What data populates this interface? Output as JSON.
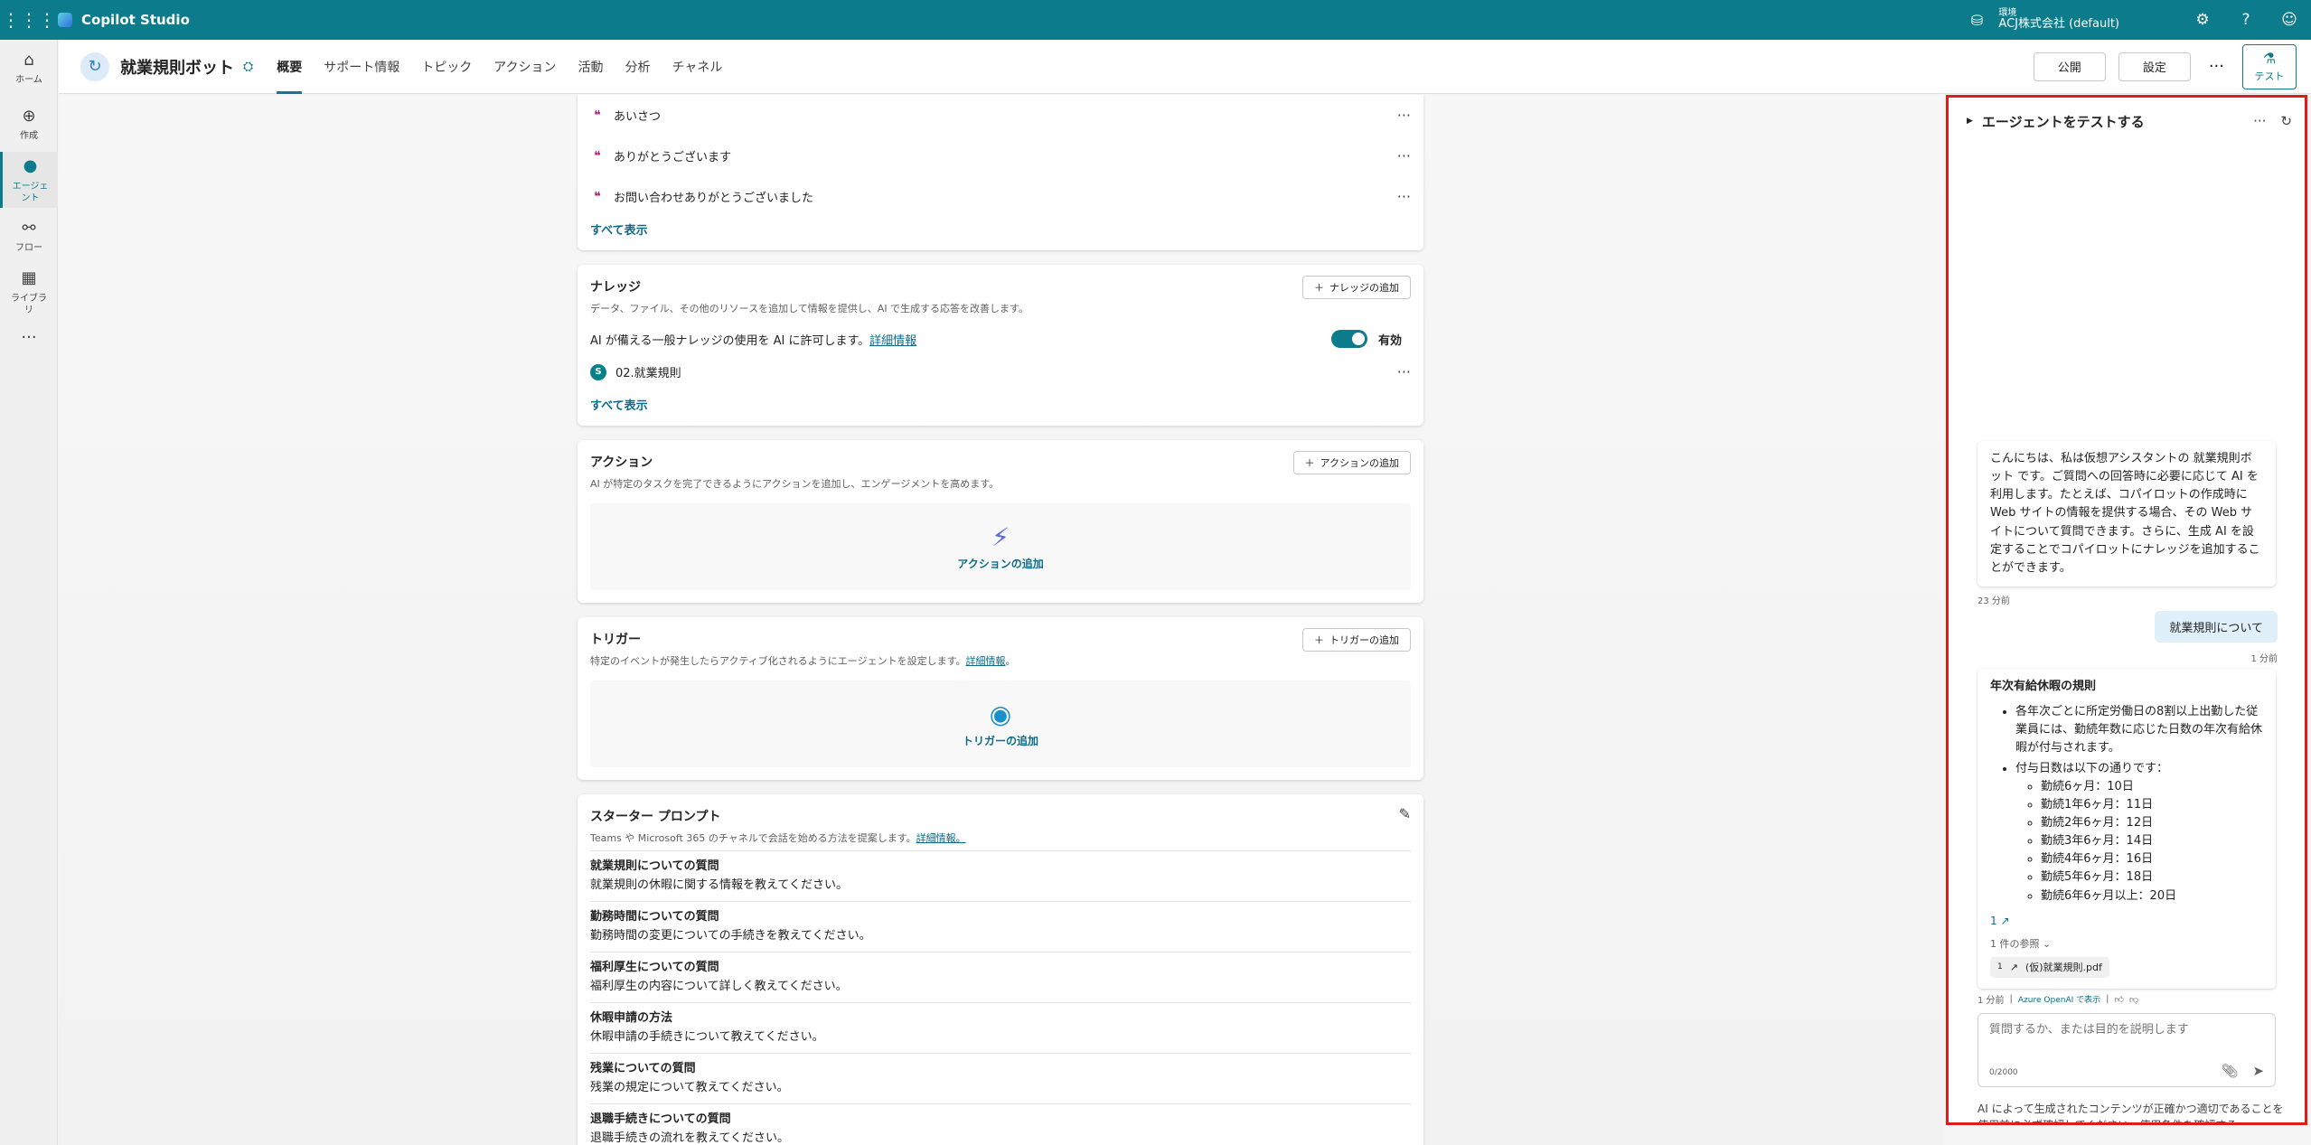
{
  "topbar": {
    "app_title": "Copilot Studio",
    "env_label": "環境",
    "env_name": "ACJ株式会社 (default)"
  },
  "rail": {
    "items": [
      {
        "label": "ホーム",
        "icon": "home-icon"
      },
      {
        "label": "作成",
        "icon": "plus-circle-icon"
      },
      {
        "label": "エージェント",
        "icon": "agent-icon"
      },
      {
        "label": "フロー",
        "icon": "flow-icon"
      },
      {
        "label": "ライブラリ",
        "icon": "library-icon"
      }
    ]
  },
  "header": {
    "agent_name": "就業規則ボット",
    "tabs": [
      "概要",
      "サポート情報",
      "トピック",
      "アクション",
      "活動",
      "分析",
      "チャネル"
    ],
    "publish_label": "公開",
    "settings_label": "設定",
    "test_label": "テスト"
  },
  "topics": {
    "items": [
      "あいさつ",
      "ありがとうございます",
      "お問い合わせありがとうございました"
    ],
    "show_all": "すべて表示"
  },
  "knowledge": {
    "title": "ナレッジ",
    "add_label": "ナレッジの追加",
    "desc": "データ、ファイル、その他のリソースを追加して情報を提供し、AI で生成する応答を改善します。",
    "general_text": "AI が備える一般ナレッジの使用を AI に許可します。",
    "detail_link": "詳細情報",
    "toggle_label": "有効",
    "source_name": "02.就業規則",
    "show_all": "すべて表示"
  },
  "actions": {
    "title": "アクション",
    "add_label": "アクションの追加",
    "desc": "AI が特定のタスクを完了できるようにアクションを追加し、エンゲージメントを高めます。",
    "empty_label": "アクションの追加"
  },
  "triggers": {
    "title": "トリガー",
    "add_label": "トリガーの追加",
    "desc": "特定のイベントが発生したらアクティブ化されるようにエージェントを設定します。",
    "detail_link": "詳細情報",
    "empty_label": "トリガーの追加"
  },
  "starter_prompts": {
    "title": "スターター プロンプト",
    "desc": "Teams や Microsoft 365 のチャネルで会話を始める方法を提案します。",
    "detail_link": "詳細情報。",
    "items": [
      {
        "title": "就業規則についての質問",
        "text": "就業規則の休暇に関する情報を教えてください。"
      },
      {
        "title": "勤務時間についての質問",
        "text": "勤務時間の変更についての手続きを教えてください。"
      },
      {
        "title": "福利厚生についての質問",
        "text": "福利厚生の内容について詳しく教えてください。"
      },
      {
        "title": "休暇申請の方法",
        "text": "休暇申請の手続きについて教えてください。"
      },
      {
        "title": "残業についての質問",
        "text": "残業の規定について教えてください。"
      },
      {
        "title": "退職手続きについての質問",
        "text": "退職手続きの流れを教えてください。"
      }
    ]
  },
  "test_panel": {
    "title": "エージェントをテストする",
    "greeting": "こんにちは、私は仮想アシスタントの 就業規則ボット です。ご質問への回答時に必要に応じて AI を利用します。たとえば、コパイロットの作成時に Web サイトの情報を提供する場合、その Web サイトについて質問できます。さらに、生成 AI を設定することでコパイロットにナレッジを追加することができます。",
    "greeting_time": "23 分前",
    "user_message": "就業規則について",
    "user_time": "1 分前",
    "answer": {
      "title": "年次有給休暇の規則",
      "bullet1": "各年次ごとに所定労働日の8割以上出勤した従業員には、勤続年数に応じた日数の年次有給休暇が付与されます。",
      "bullet2": "付与日数は以下の通りです：",
      "sub_items": [
        "勤続6ヶ月：10日",
        "勤続1年6ヶ月：11日",
        "勤続2年6ヶ月：12日",
        "勤続3年6ヶ月：14日",
        "勤続4年6ヶ月：16日",
        "勤続5年6ヶ月：18日",
        "勤続6年6ヶ月以上：20日"
      ],
      "citation": "1",
      "refs_label": "1 件の参照",
      "ref_num": "1",
      "ref_file": "(仮)就業規則.pdf"
    },
    "answer_time": "1 分前",
    "answer_source": "Azure OpenAI で表示",
    "input_placeholder": "質問するか、または目的を説明します",
    "input_count": "0/2000",
    "disclaimer": "AI によって生成されたコンテンツが正確かつ適切であることを使用前に必ず確認してください。使用条件を確認する"
  }
}
